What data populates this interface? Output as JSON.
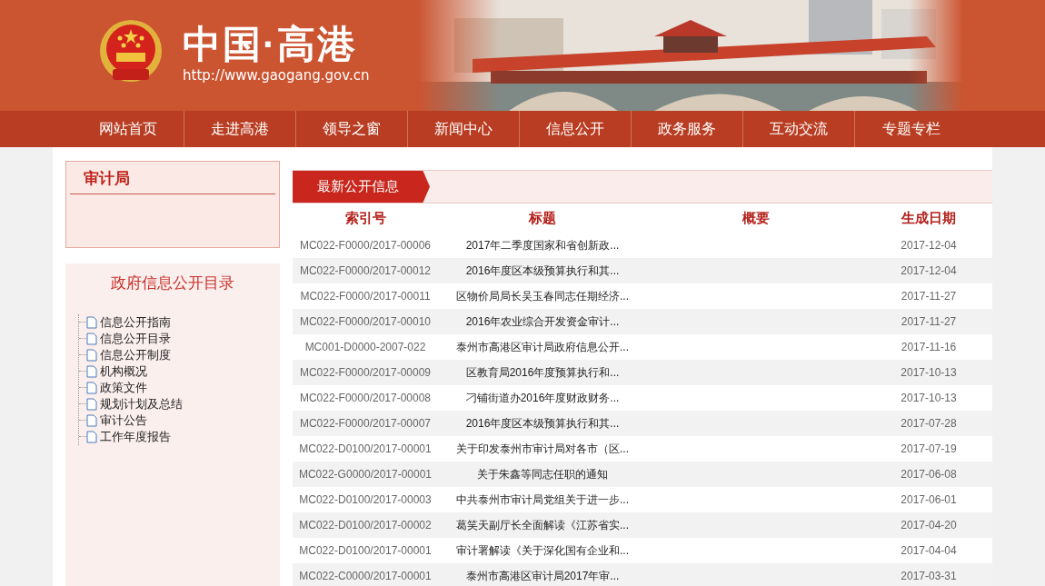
{
  "header": {
    "site_title": "中国·高港",
    "site_url": "http://www.gaogang.gov.cn"
  },
  "nav": [
    {
      "label": "网站首页"
    },
    {
      "label": "走进高港"
    },
    {
      "label": "领导之窗"
    },
    {
      "label": "新闻中心"
    },
    {
      "label": "信息公开"
    },
    {
      "label": "政务服务"
    },
    {
      "label": "互动交流"
    },
    {
      "label": "专题专栏"
    }
  ],
  "sidebar": {
    "department": "审计局",
    "catalog_title": "政府信息公开目录",
    "items": [
      {
        "label": "信息公开指南"
      },
      {
        "label": "信息公开目录"
      },
      {
        "label": "信息公开制度"
      },
      {
        "label": "机构概况"
      },
      {
        "label": "政策文件"
      },
      {
        "label": "规划计划及总结"
      },
      {
        "label": "审计公告"
      },
      {
        "label": "工作年度报告"
      }
    ]
  },
  "main": {
    "tab": "最新公开信息",
    "table": {
      "columns": [
        "索引号",
        "标题",
        "概要",
        "生成日期"
      ],
      "rows": [
        [
          "MC022-F0000/2017-00006",
          "2017年二季度国家和省创新政...",
          "2017-12-04"
        ],
        [
          "MC022-F0000/2017-00012",
          "2016年度区本级预算执行和其...",
          "2017-12-04"
        ],
        [
          "MC022-F0000/2017-00011",
          "区物价局局长吴玉春同志任期经济...",
          "2017-11-27"
        ],
        [
          "MC022-F0000/2017-00010",
          "2016年农业综合开发资金审计...",
          "2017-11-27"
        ],
        [
          "MC001-D0000-2007-022",
          "泰州市高港区审计局政府信息公开...",
          "2017-11-16"
        ],
        [
          "MC022-F0000/2017-00009",
          "区教育局2016年度预算执行和...",
          "2017-10-13"
        ],
        [
          "MC022-F0000/2017-00008",
          "刁铺街道办2016年度财政财务...",
          "2017-10-13"
        ],
        [
          "MC022-F0000/2017-00007",
          "2016年度区本级预算执行和其...",
          "2017-07-28"
        ],
        [
          "MC022-D0100/2017-00001",
          "关于印发泰州市审计局对各市（区...",
          "2017-07-19"
        ],
        [
          "MC022-G0000/2017-00001",
          "关于朱鑫等同志任职的通知",
          "2017-06-08"
        ],
        [
          "MC022-D0100/2017-00003",
          "中共泰州市审计局党组关于进一步...",
          "2017-06-01"
        ],
        [
          "MC022-D0100/2017-00002",
          "葛笑天副厅长全面解读《江苏省实...",
          "2017-04-20"
        ],
        [
          "MC022-D0100/2017-00001",
          "审计署解读《关于深化国有企业和...",
          "2017-04-04"
        ],
        [
          "MC022-C0000/2017-00001",
          "泰州市高港区审计局2017年审...",
          "2017-03-31"
        ]
      ]
    }
  }
}
